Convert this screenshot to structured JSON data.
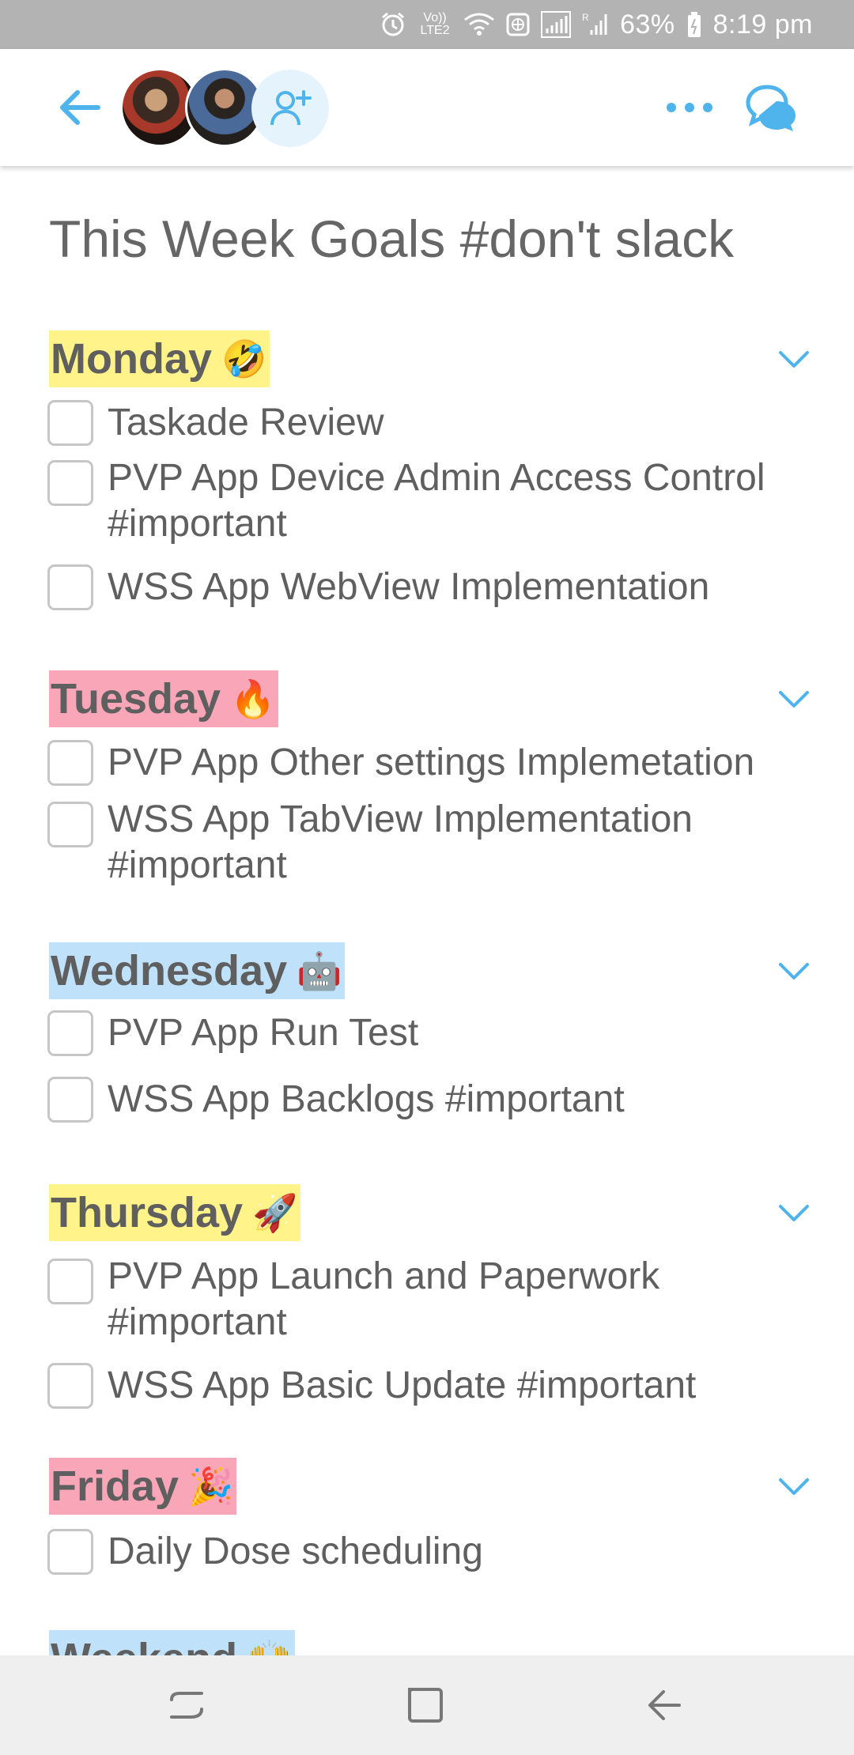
{
  "status_bar": {
    "network_label": "Vo)) LTE2",
    "sim_label": "R",
    "battery": "63%",
    "time": "8:19 pm"
  },
  "header": {
    "icons": [
      "back-arrow-icon",
      "avatar",
      "avatar",
      "add-member-icon",
      "more-dots-icon",
      "chat-icon"
    ]
  },
  "page": {
    "title": "This Week Goals #don't slack"
  },
  "sections": [
    {
      "day": "Monday",
      "emoji": "🤣",
      "highlight": "#fff38a",
      "tasks": [
        "Taskade Review",
        "PVP App Device Admin Access Control #important",
        "WSS App WebView Implementation"
      ]
    },
    {
      "day": "Tuesday",
      "emoji": "🔥",
      "highlight": "#f9a6b8",
      "tasks": [
        "PVP App Other settings Implemetation",
        "WSS App TabView Implementation #important"
      ]
    },
    {
      "day": "Wednesday",
      "emoji": "🤖",
      "highlight": "#bfe2fa",
      "tasks": [
        "PVP App Run Test",
        "WSS App Backlogs #important"
      ]
    },
    {
      "day": "Thursday",
      "emoji": "🚀",
      "highlight": "#fff38a",
      "tasks": [
        "PVP App Launch and Paperwork #important",
        "WSS App Basic Update #important"
      ]
    },
    {
      "day": "Friday",
      "emoji": "🎉",
      "highlight": "#f9a6b8",
      "tasks": [
        "Daily Dose scheduling"
      ]
    },
    {
      "day": "Weekend",
      "emoji": "🙌",
      "highlight": "#bfe2fa",
      "tasks": []
    }
  ],
  "colors": {
    "accent": "#4fb3ec",
    "status_bar": "#b3b3b3",
    "nav_bar": "#efefef"
  },
  "nav": {
    "icons": [
      "recents-icon",
      "home-icon",
      "back-icon"
    ]
  }
}
